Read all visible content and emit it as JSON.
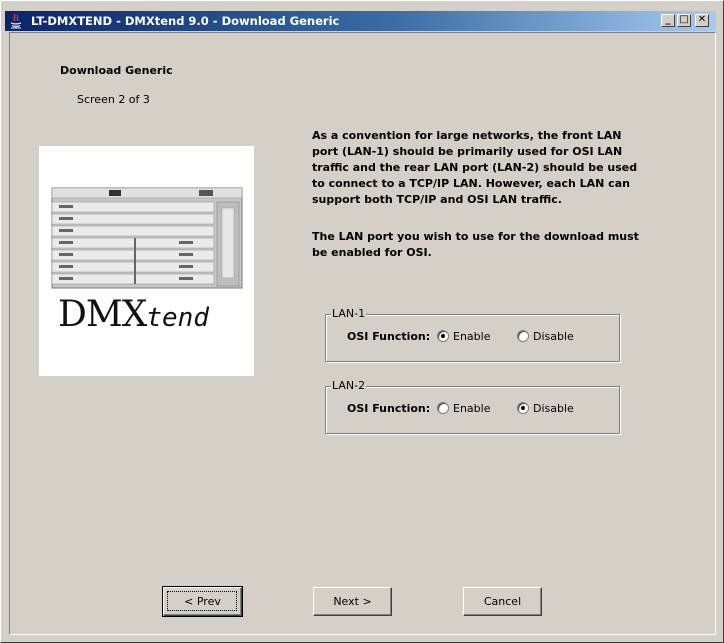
{
  "window": {
    "title": "LT-DMXTEND - DMXtend 9.0 - Download Generic",
    "minimize_glyph": "_",
    "maximize_glyph": "□",
    "close_glyph": "✕"
  },
  "header": {
    "title": "Download Generic",
    "screen_count": "Screen 2 of 3"
  },
  "product_image": {
    "logo_main": "DMX",
    "logo_suffix": "tend"
  },
  "instructions": {
    "paragraph1": "As a convention for large networks, the front LAN port (LAN-1) should be primarily used for OSI LAN traffic and the rear LAN port (LAN-2) should be used to connect to a TCP/IP LAN.  However, each LAN can support both TCP/IP and OSI LAN traffic.",
    "paragraph2": "The LAN port you wish to use for the download must be enabled for OSI."
  },
  "lan1": {
    "legend": "LAN-1",
    "osi_label": "OSI Function:",
    "enable_label": "Enable",
    "disable_label": "Disable",
    "selected": "Enable"
  },
  "lan2": {
    "legend": "LAN-2",
    "osi_label": "OSI Function:",
    "enable_label": "Enable",
    "disable_label": "Disable",
    "selected": "Disable"
  },
  "buttons": {
    "prev": "< Prev",
    "next": "Next >",
    "cancel": "Cancel"
  }
}
